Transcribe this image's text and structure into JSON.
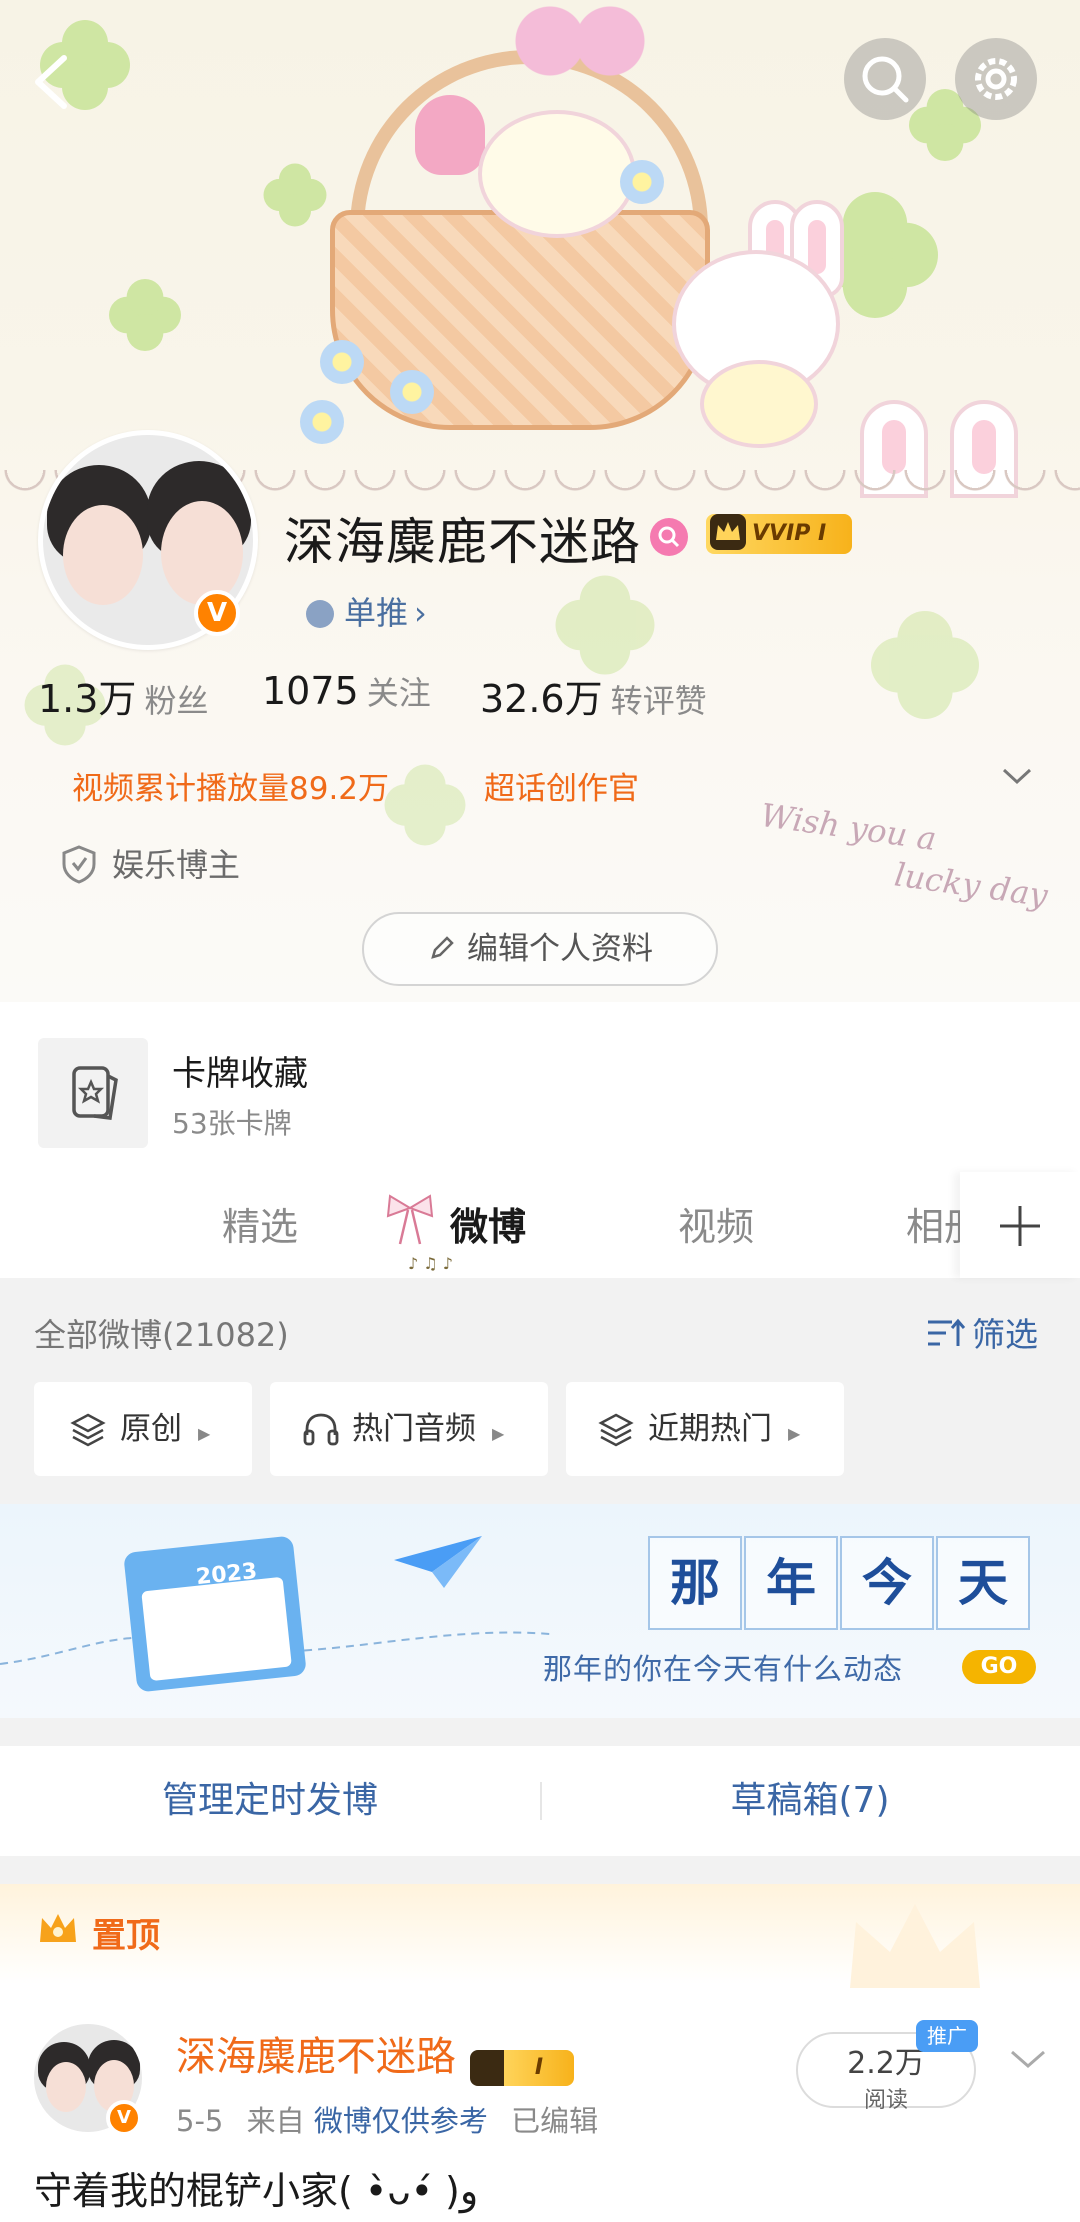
{
  "profile": {
    "username": "深海麋鹿不迷路",
    "vip_badge": "VVIP",
    "vip_level": "I",
    "verified_mark": "V",
    "support_label": "单推",
    "stats": [
      {
        "value": "1.3万",
        "label": "粉丝"
      },
      {
        "value": "1075",
        "label": "关注"
      },
      {
        "value": "32.6万",
        "label": "转评赞"
      }
    ],
    "highlight_1": "视频累计播放量89.2万",
    "highlight_2": "超话创作官",
    "tag": "娱乐博主",
    "edit_button": "编辑个人资料",
    "banner_script_1": "Wish you a",
    "banner_script_2": "lucky day"
  },
  "cards": {
    "title": "卡牌收藏",
    "subtitle": "53张卡牌"
  },
  "tabs": [
    "精选",
    "微博",
    "视频",
    "相册"
  ],
  "feed": {
    "count_label": "全部微博(21082)",
    "filter_label": "筛选",
    "chips": [
      "原创",
      "热门音频",
      "近期热门"
    ]
  },
  "memory_banner": {
    "chars": [
      "那",
      "年",
      "今",
      "天"
    ],
    "subtitle": "那年的你在今天有什么动态",
    "go_label": "GO",
    "calendar_year": "2023"
  },
  "actions": {
    "scheduled": "管理定时发博",
    "drafts": "草稿箱(7)"
  },
  "pinned_post": {
    "pin_label": "置顶",
    "author": "深海麋鹿不迷路",
    "vip_level": "I",
    "date": "5-5",
    "from_prefix": "来自",
    "source": "微博仅供参考",
    "edited": "已编辑",
    "reads_value": "2.2万",
    "reads_label": "阅读",
    "promo": "推广",
    "text": "守着我的棍铲小家( •̀ᴗ•́ )و"
  },
  "colors": {
    "accent_orange": "#f06a19",
    "link_blue": "#3a66a5",
    "vip_gold": "#f7b21b",
    "verified": "#ff8200"
  }
}
